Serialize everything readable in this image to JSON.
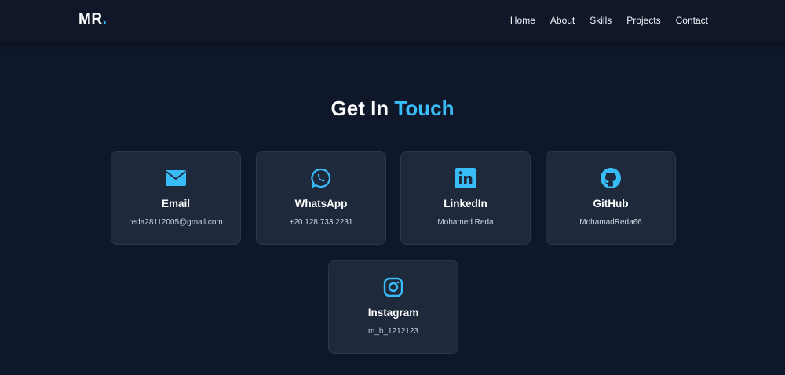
{
  "nav": {
    "logo_text": "MR",
    "logo_dot": ".",
    "links": [
      "Home",
      "About",
      "Skills",
      "Projects",
      "Contact"
    ]
  },
  "heading": {
    "part1": "Get In",
    "part2": "Touch"
  },
  "contacts": [
    {
      "title": "Email",
      "value": "reda28112005@gmail.com",
      "icon": "envelope-icon"
    },
    {
      "title": "WhatsApp",
      "value": "+20 128 733 2231",
      "icon": "whatsapp-icon"
    },
    {
      "title": "LinkedIn",
      "value": "Mohamed Reda",
      "icon": "linkedin-icon"
    },
    {
      "title": "GitHub",
      "value": "MohamadReda66",
      "icon": "github-icon"
    },
    {
      "title": "Instagram",
      "value": "m_h_1212123",
      "icon": "instagram-icon"
    }
  ],
  "colors": {
    "background": "#0f172a",
    "card": "#1e293b",
    "accent": "#38bdf8"
  }
}
